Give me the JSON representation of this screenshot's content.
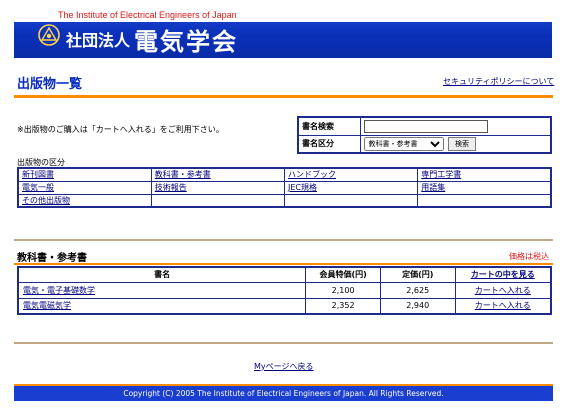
{
  "header": {
    "institute_en": "The Institute of Electrical Engineers of Japan",
    "corp_type": "社団法人",
    "name": "電気学会",
    "logo_icon": "iee-logo-icon",
    "colors": {
      "banner": "#0b30b8",
      "accent": "#ff8c00",
      "subtitle": "#e01818"
    }
  },
  "page": {
    "title": "出版物一覧",
    "security_link": "セキュリティポリシーについて"
  },
  "notice": "※出版物のご購入は「カートへ入れる」をご利用下さい。",
  "search": {
    "name_label": "書名検索",
    "name_value": "",
    "category_label": "書名区分",
    "category_selected": "教科書・参考書",
    "button_label": "検索"
  },
  "categories": {
    "caption": "出版物の区分",
    "items": [
      "新刊図書",
      "教科書・参考書",
      "ハンドブック",
      "専門工学書",
      "電気一般",
      "技術報告",
      "JEC規格",
      "用語集",
      "その他出版物"
    ]
  },
  "section": {
    "title": "教科書・参考書",
    "tax_note": "価格は税込"
  },
  "books": {
    "headers": {
      "name": "書名",
      "member_price": "会員特価(円)",
      "list_price": "定価(円)",
      "cart_header": "カートの中を見る"
    },
    "rows": [
      {
        "title": "電気・電子基礎数学",
        "member_price": "2,100",
        "list_price": "2,625",
        "cart": "カートへ入れる"
      },
      {
        "title": "電気電磁気学",
        "member_price": "2,352",
        "list_price": "2,940",
        "cart": "カートへ入れる"
      }
    ]
  },
  "mypage_link": "Myページへ戻る",
  "footer": "Copyright (C) 2005 The Institute of Electrical Engineers of Japan. All Rights Reserved."
}
